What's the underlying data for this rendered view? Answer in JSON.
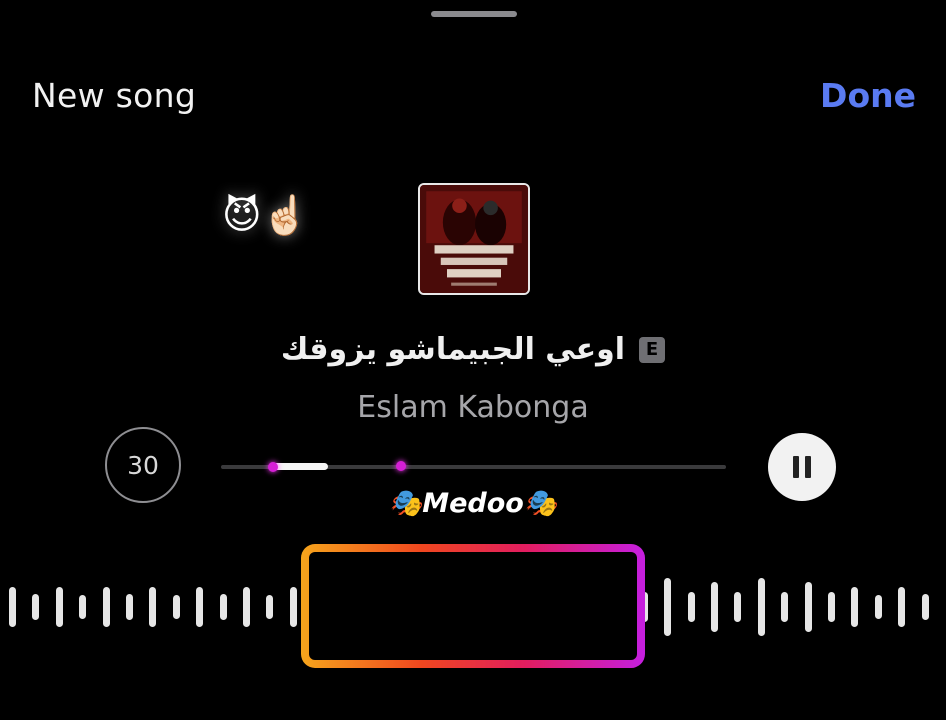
{
  "header": {
    "title": "New song",
    "done_label": "Done"
  },
  "sticker": {
    "emoji": "😈☝🏻"
  },
  "song": {
    "title": "اوعي الجبيماشو يزوقك",
    "explicit_badge": "E",
    "artist": "Eslam Kabonga",
    "clip_duration": "30"
  },
  "caption": {
    "text": "🎭Medoo🎭"
  },
  "player": {
    "state": "playing",
    "pause_icon": "pause-icon",
    "progress_fraction": 0.36
  },
  "colors": {
    "done": "#5a7bf2",
    "accent_dot": "#d61fd6",
    "frame_gradient": [
      "#f6a51c",
      "#f0471f",
      "#e21d5f",
      "#c51fe0"
    ]
  }
}
